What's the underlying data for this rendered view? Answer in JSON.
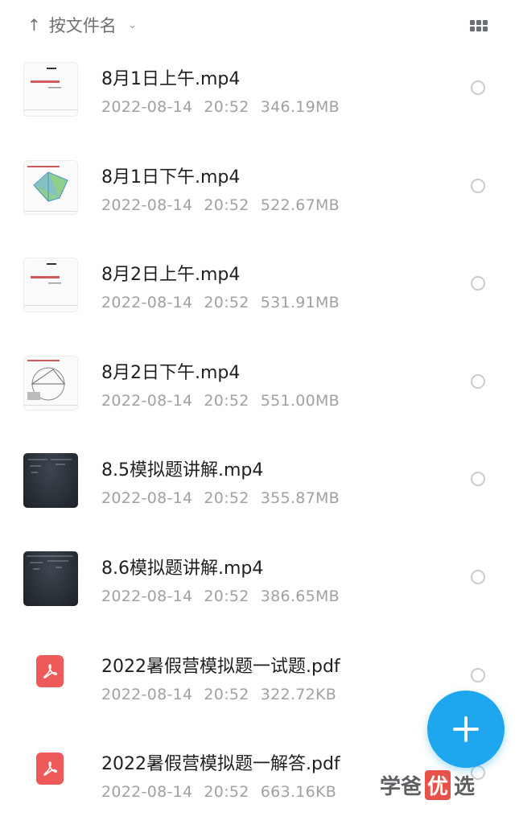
{
  "header": {
    "sort_arrow": "↑",
    "sort_label": "按文件名",
    "sort_chevron": "⌄",
    "view_icon": "grid-icon"
  },
  "files": [
    {
      "name": "8月1日上午.mp4",
      "date": "2022-08-14",
      "time": "20:52",
      "size": "346.19MB",
      "thumb": "doc-slide"
    },
    {
      "name": "8月1日下午.mp4",
      "date": "2022-08-14",
      "time": "20:52",
      "size": "522.67MB",
      "thumb": "doc-diagram"
    },
    {
      "name": "8月2日上午.mp4",
      "date": "2022-08-14",
      "time": "20:52",
      "size": "531.91MB",
      "thumb": "doc-slide"
    },
    {
      "name": "8月2日下午.mp4",
      "date": "2022-08-14",
      "time": "20:52",
      "size": "551.00MB",
      "thumb": "doc-geometry"
    },
    {
      "name": "8.5模拟题讲解.mp4",
      "date": "2022-08-14",
      "time": "20:52",
      "size": "355.87MB",
      "thumb": "blackboard"
    },
    {
      "name": "8.6模拟题讲解.mp4",
      "date": "2022-08-14",
      "time": "20:52",
      "size": "386.65MB",
      "thumb": "blackboard"
    },
    {
      "name": "2022暑假营模拟题一试题.pdf",
      "date": "2022-08-14",
      "time": "20:52",
      "size": "322.72KB",
      "thumb": "pdf-icon"
    },
    {
      "name": "2022暑假营模拟题一解答.pdf",
      "date": "2022-08-14",
      "time": "20:52",
      "size": "663.16KB",
      "thumb": "pdf-icon"
    }
  ],
  "fab": {
    "icon": "plus-icon"
  },
  "watermark": {
    "part1": "学爸",
    "highlight": "优",
    "part2": "选"
  },
  "colors": {
    "accent": "#1ea7ee",
    "pdf": "#ee5a5a",
    "meta": "#9fa1a5"
  }
}
